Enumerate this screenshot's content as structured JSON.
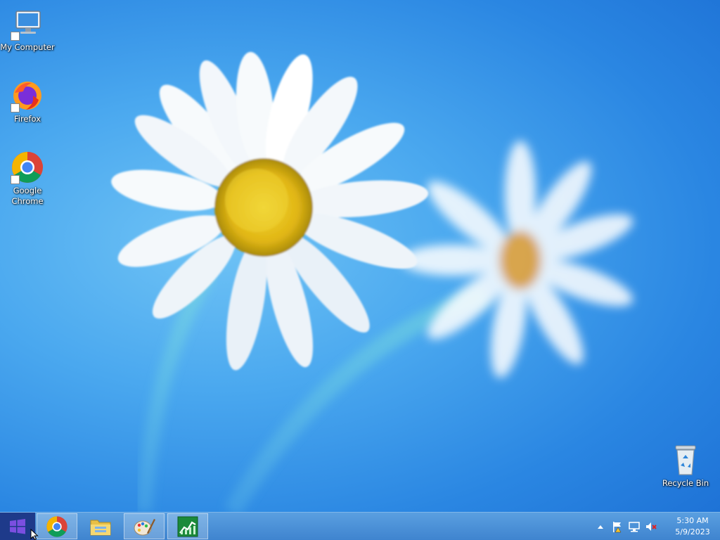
{
  "desktop": {
    "icons": [
      {
        "label": "My Computer",
        "icon": "computer-icon"
      },
      {
        "label": "Firefox",
        "icon": "firefox-icon"
      },
      {
        "label": "Google\nChrome",
        "icon": "chrome-icon"
      },
      {
        "label": "Recycle Bin",
        "icon": "recycle-bin-icon"
      }
    ]
  },
  "taskbar": {
    "start_icon": "windows-logo-icon",
    "pinned": [
      {
        "icon": "chrome-icon",
        "active": true
      },
      {
        "icon": "file-explorer-icon",
        "active": false
      },
      {
        "icon": "paint-icon",
        "active": true
      },
      {
        "icon": "task-manager-icon",
        "active": true
      }
    ],
    "tray": {
      "icons": [
        "show-hidden-icons-chevron",
        "action-center-flag-icon",
        "network-icon",
        "volume-muted-icon"
      ],
      "time": "5:30 AM",
      "date": "5/9/2023"
    }
  },
  "colors": {
    "taskbar": "#3f84cf",
    "start_button": "#1e3a8a",
    "desktop_sky": "#2a86e2"
  }
}
